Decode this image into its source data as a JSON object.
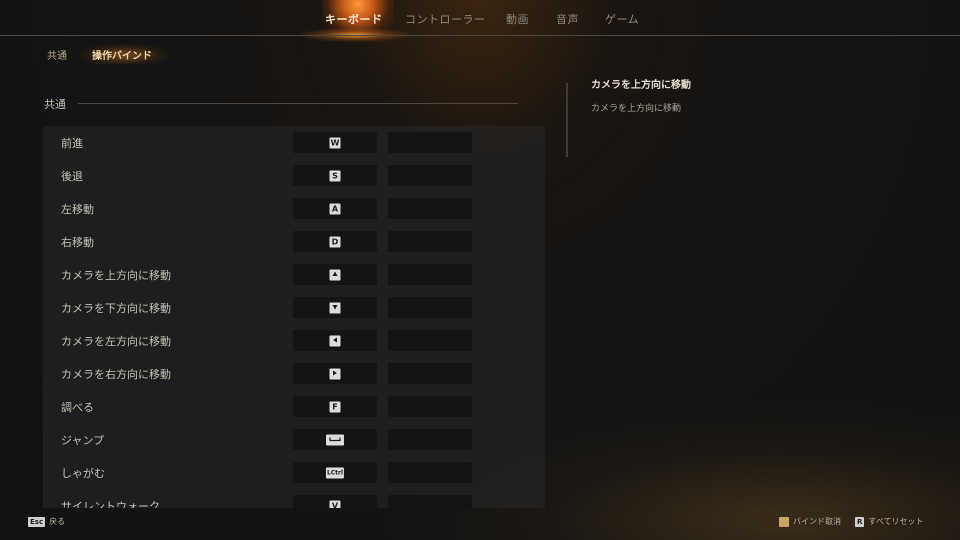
{
  "nav": {
    "tabs": [
      {
        "label": "キーボード",
        "active": true
      },
      {
        "label": "コントローラー",
        "active": false
      },
      {
        "label": "動画",
        "active": false
      },
      {
        "label": "音声",
        "active": false
      },
      {
        "label": "ゲーム",
        "active": false
      }
    ]
  },
  "subnav": {
    "tabs": [
      {
        "label": "共通",
        "active": false
      },
      {
        "label": "操作バインド",
        "active": true
      }
    ]
  },
  "section": {
    "title": "共通"
  },
  "bindings": [
    {
      "action": "前進",
      "key": "W",
      "key_icon": "key-w"
    },
    {
      "action": "後退",
      "key": "S",
      "key_icon": "key-s"
    },
    {
      "action": "左移動",
      "key": "A",
      "key_icon": "key-a"
    },
    {
      "action": "右移動",
      "key": "D",
      "key_icon": "key-d"
    },
    {
      "action": "カメラを上方向に移動",
      "key": "",
      "key_icon": "arrow-up-icon"
    },
    {
      "action": "カメラを下方向に移動",
      "key": "",
      "key_icon": "arrow-down-icon"
    },
    {
      "action": "カメラを左方向に移動",
      "key": "",
      "key_icon": "arrow-left-icon"
    },
    {
      "action": "カメラを右方向に移動",
      "key": "",
      "key_icon": "arrow-right-icon"
    },
    {
      "action": "調べる",
      "key": "F",
      "key_icon": "key-f"
    },
    {
      "action": "ジャンプ",
      "key": "",
      "key_icon": "spacebar-icon"
    },
    {
      "action": "しゃがむ",
      "key": "LCtrl",
      "key_icon": "key-lctrl"
    },
    {
      "action": "サイレントウォーク",
      "key": "V",
      "key_icon": "key-v"
    }
  ],
  "detail": {
    "title": "カメラを上方向に移動",
    "description": "カメラを上方向に移動"
  },
  "footer": {
    "back": {
      "key": "Esc",
      "label": "戻る"
    },
    "unbind": {
      "key_icon": "book-icon",
      "label": "バインド取消"
    },
    "reset_all": {
      "key": "R",
      "label": "すべてリセット"
    }
  },
  "colors": {
    "accent": "#f0d9a8",
    "flame": "#e07a2c",
    "panel": "#2a2a2a",
    "slot": "#141414"
  }
}
